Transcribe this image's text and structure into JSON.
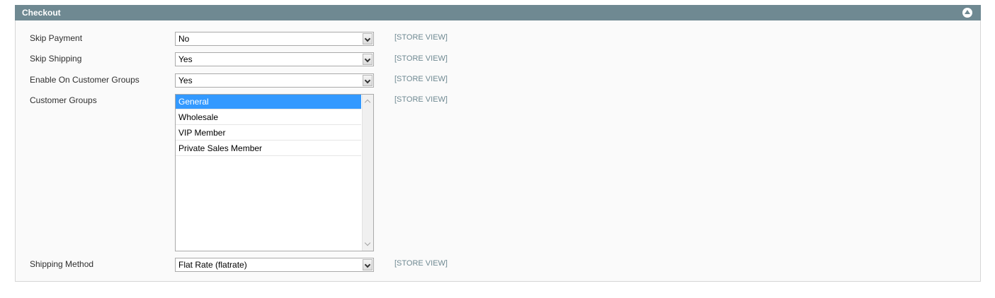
{
  "section": {
    "title": "Checkout"
  },
  "fields": {
    "skip_payment": {
      "label": "Skip Payment",
      "value": "No",
      "scope": "[STORE VIEW]"
    },
    "skip_shipping": {
      "label": "Skip Shipping",
      "value": "Yes",
      "scope": "[STORE VIEW]"
    },
    "enable_customer_groups": {
      "label": "Enable On Customer Groups",
      "value": "Yes",
      "scope": "[STORE VIEW]"
    },
    "customer_groups": {
      "label": "Customer Groups",
      "scope": "[STORE VIEW]",
      "options": [
        "General",
        "Wholesale",
        "VIP Member",
        "Private Sales Member"
      ],
      "selected": "General"
    },
    "shipping_method": {
      "label": "Shipping Method",
      "value": "Flat Rate (flatrate)",
      "scope": "[STORE VIEW]"
    }
  },
  "colors": {
    "header_bg": "#6f8992",
    "selected_option_bg": "#3399ff",
    "scope_text": "#6f8992"
  },
  "icons": {
    "collapse": "collapse-up-icon",
    "dropdown": "chevron-down-icon"
  }
}
